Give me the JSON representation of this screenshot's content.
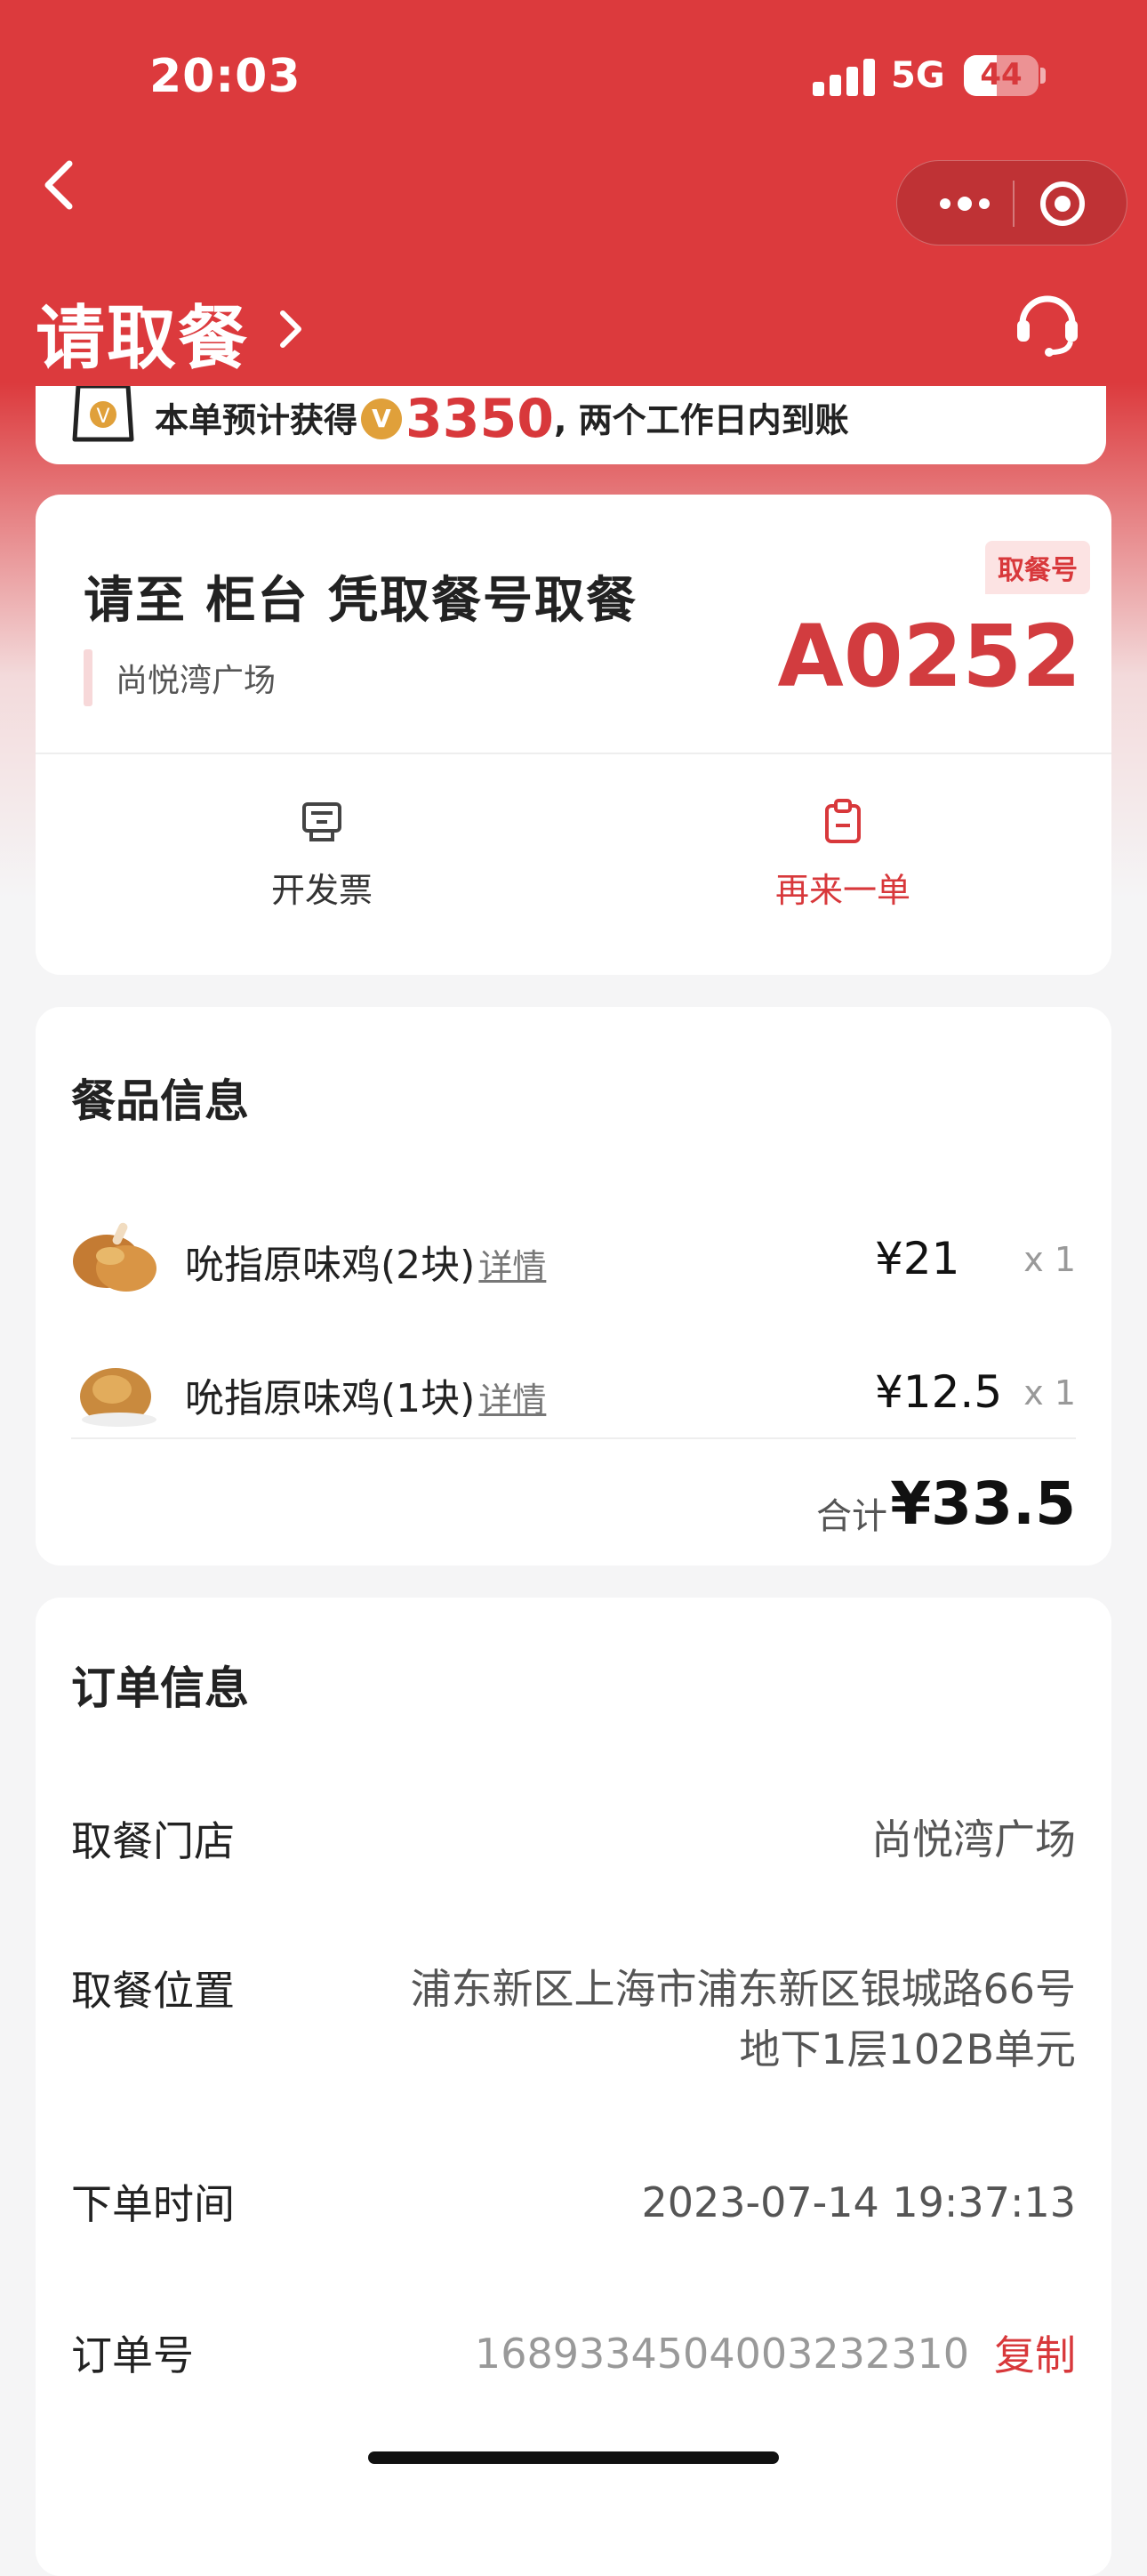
{
  "status_bar": {
    "time": "20:03",
    "network": "5G",
    "battery": "44",
    "battery_level": 0.44
  },
  "header": {
    "title": "请取餐"
  },
  "points": {
    "prefix": "本单预计获得",
    "coin": "V",
    "amount": "3350",
    "suffix": ", 两个工作日内到账"
  },
  "pickup": {
    "instruction": "请至 柜台 凭取餐号取餐",
    "store": "尚悦湾广场",
    "tag": "取餐号",
    "number": "A0252",
    "actions": [
      {
        "label": "开发票",
        "icon": "receipt-icon"
      },
      {
        "label": "再来一单",
        "icon": "clipboard-icon"
      }
    ]
  },
  "items": {
    "title": "餐品信息",
    "list": [
      {
        "name": "吮指原味鸡(2块)",
        "detail": "详情",
        "price": "¥21",
        "qty": "x 1"
      },
      {
        "name": "吮指原味鸡(1块)",
        "detail": "详情",
        "price": "¥12.5",
        "qty": "x 1"
      }
    ],
    "total_label": "合计",
    "total": "¥33.5"
  },
  "order": {
    "title": "订单信息",
    "store_label": "取餐门店",
    "store": "尚悦湾广场",
    "location_label": "取餐位置",
    "location_line1": "浦东新区上海市浦东新区银城路66号",
    "location_line2": "地下1层102B单元",
    "time_label": "下单时间",
    "time": "2023-07-14 19:37:13",
    "number_label": "订单号",
    "number": "1689334504003232310",
    "copy": "复制"
  },
  "colors": {
    "brand": "#dc3a3d",
    "accent": "#d23c3f",
    "coin": "#e0a03a"
  }
}
